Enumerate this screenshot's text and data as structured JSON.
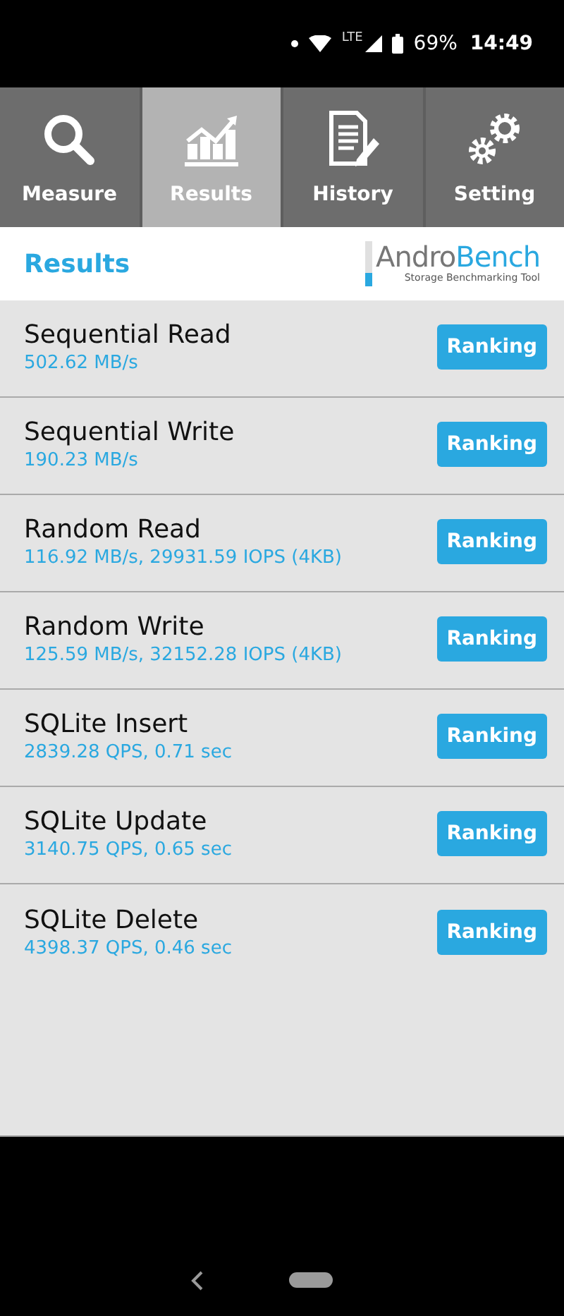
{
  "status_bar": {
    "network": "LTE",
    "battery": "69%",
    "time": "14:49"
  },
  "tabs": [
    {
      "label": "Measure",
      "kind": "measure",
      "selected": false
    },
    {
      "label": "Results",
      "kind": "results",
      "selected": true
    },
    {
      "label": "History",
      "kind": "history",
      "selected": false
    },
    {
      "label": "Setting",
      "kind": "setting",
      "selected": false
    }
  ],
  "header": {
    "title": "Results",
    "logo": {
      "name_start": "Andro",
      "name_end": "Bench",
      "tagline": "Storage Benchmarking Tool"
    }
  },
  "results": [
    {
      "name": "Sequential Read",
      "value": "502.62 MB/s",
      "button": "Ranking"
    },
    {
      "name": "Sequential Write",
      "value": "190.23 MB/s",
      "button": "Ranking"
    },
    {
      "name": "Random Read",
      "value": "116.92 MB/s, 29931.59 IOPS (4KB)",
      "button": "Ranking"
    },
    {
      "name": "Random Write",
      "value": "125.59 MB/s, 32152.28 IOPS (4KB)",
      "button": "Ranking"
    },
    {
      "name": "SQLite Insert",
      "value": "2839.28 QPS, 0.71 sec",
      "button": "Ranking"
    },
    {
      "name": "SQLite Update",
      "value": "3140.75 QPS, 0.65 sec",
      "button": "Ranking"
    },
    {
      "name": "SQLite Delete",
      "value": "4398.37 QPS, 0.46 sec",
      "button": "Ranking"
    }
  ]
}
